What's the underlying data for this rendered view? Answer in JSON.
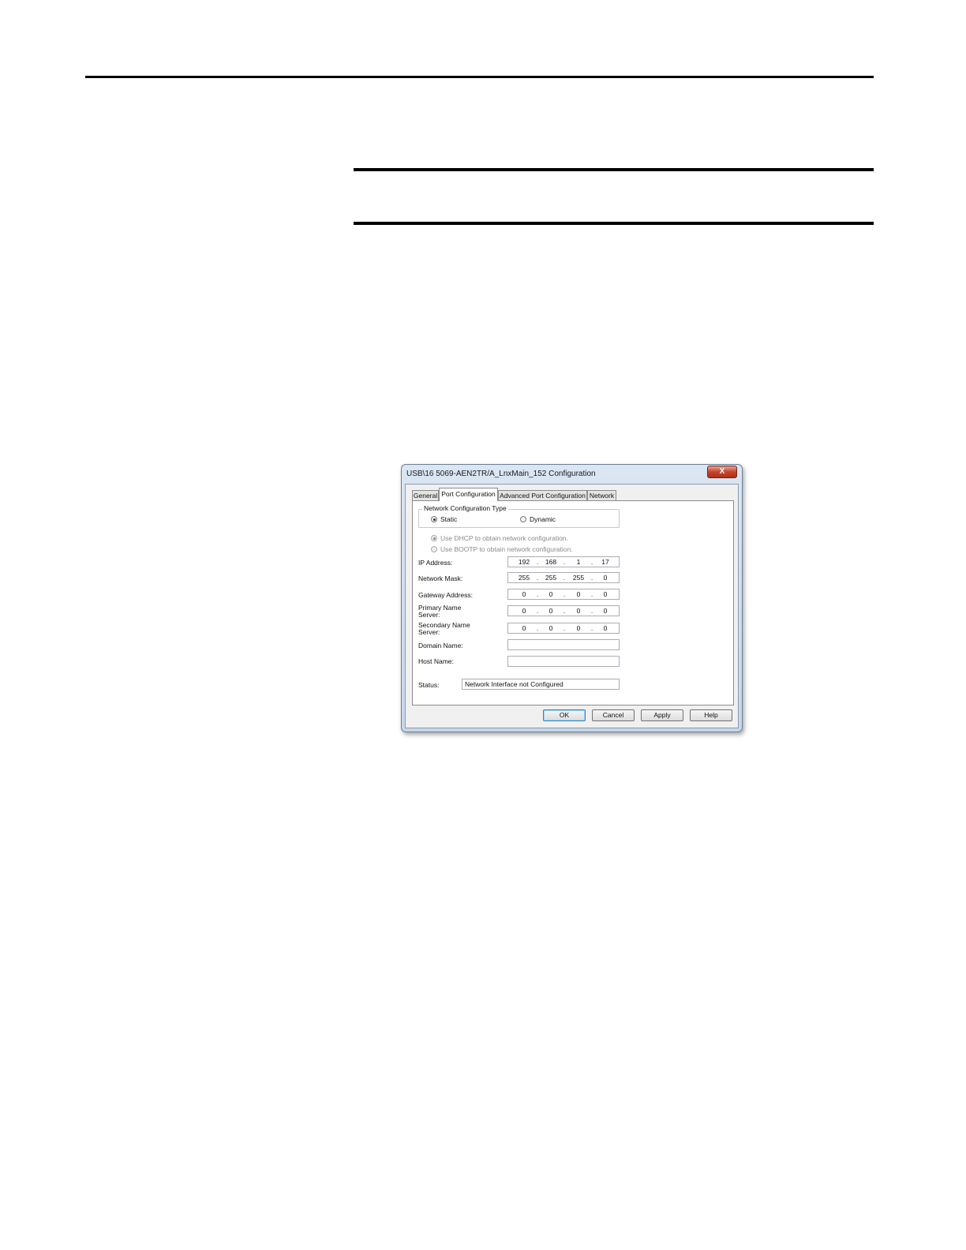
{
  "dialog": {
    "title": "USB\\16 5069-AEN2TR/A_LnxMain_152 Configuration",
    "close_glyph": "X"
  },
  "tabs": [
    {
      "label": "General"
    },
    {
      "label": "Port Configuration",
      "active": true
    },
    {
      "label": "Advanced Port Configuration"
    },
    {
      "label": "Network"
    }
  ],
  "network_config": {
    "group_title": "Network Configuration Type",
    "static_label": "Static",
    "dynamic_label": "Dynamic",
    "selected": "Static",
    "dhcp_label": "Use DHCP to obtain network configuration.",
    "bootp_label": "Use BOOTP to obtain network configuration."
  },
  "fields": {
    "ip_address": {
      "label": "IP Address:",
      "octets": [
        "192",
        "168",
        "1",
        "17"
      ]
    },
    "network_mask": {
      "label": "Network Mask:",
      "octets": [
        "255",
        "255",
        "255",
        "0"
      ]
    },
    "gateway": {
      "label": "Gateway Address:",
      "octets": [
        "0",
        "0",
        "0",
        "0"
      ]
    },
    "primary_dns": {
      "label_line1": "Primary Name",
      "label_line2": "Server:",
      "octets": [
        "0",
        "0",
        "0",
        "0"
      ]
    },
    "secondary_dns": {
      "label_line1": "Secondary Name",
      "label_line2": "Server:",
      "octets": [
        "0",
        "0",
        "0",
        "0"
      ]
    },
    "domain_name": {
      "label": "Domain Name:",
      "value": ""
    },
    "host_name": {
      "label": "Host Name:",
      "value": ""
    },
    "status": {
      "label": "Status:",
      "value": "Network Interface not Configured"
    }
  },
  "buttons": {
    "ok": "OK",
    "cancel": "Cancel",
    "apply": "Apply",
    "help": "Help"
  },
  "dot_separator": "."
}
